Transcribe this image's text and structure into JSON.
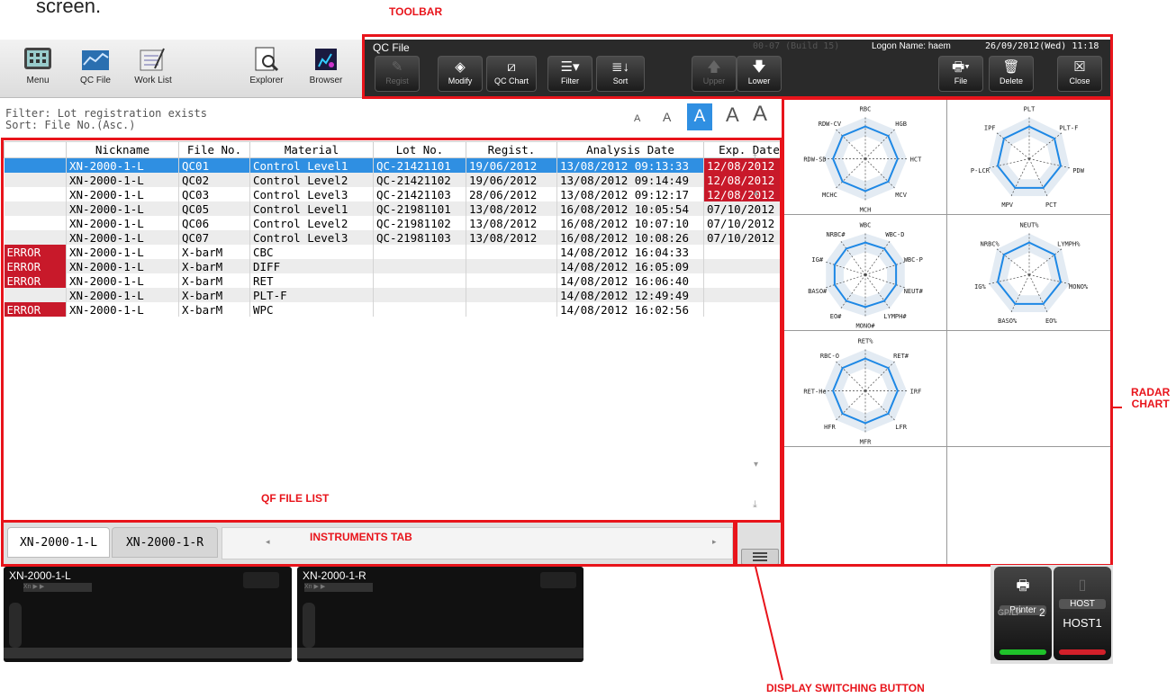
{
  "snippet_text": "screen.",
  "annotations": {
    "toolbar": "TOOLBAR",
    "qf_file_list": "QF FILE LIST",
    "instruments_tab": "INSTRUMENTS TAB",
    "radar_chart_line1": "RADAR",
    "radar_chart_line2": "CHART",
    "display_switching": "DISPLAY SWITCHING BUTTON"
  },
  "left_toolbar": [
    "Menu",
    "QC File",
    "Work List",
    "Explorer",
    "Browser"
  ],
  "dark_toolbar": {
    "title": "QC File",
    "build": "00-07 (Build 15)",
    "logon": "Logon Name: haem",
    "datetime": "26/09/2012(Wed) 11:18",
    "buttons": {
      "regist": "Regist",
      "modify": "Modify",
      "qc_chart": "QC Chart",
      "filter": "Filter",
      "sort": "Sort",
      "upper": "Upper",
      "lower": "Lower",
      "file": "File",
      "delete": "Delete",
      "close": "Close"
    }
  },
  "filter_info": {
    "filter": "Filter: Lot registration exists",
    "sort": "Sort:   File No.(Asc.)"
  },
  "font_sizes": [
    "A",
    "A",
    "A",
    "A",
    "A"
  ],
  "table": {
    "headers": [
      "Nickname",
      "File No.",
      "Material",
      "Lot No.",
      "Regist.",
      "Analysis Date",
      "Exp. Date"
    ],
    "rows": [
      {
        "status": "",
        "cells": [
          "XN-2000-1-L",
          "QC01",
          "Control Level1",
          "QC-21421101",
          "19/06/2012",
          "13/08/2012 09:13:33",
          "12/08/2012"
        ]
      },
      {
        "status": "",
        "cells": [
          "XN-2000-1-L",
          "QC02",
          "Control Level2",
          "QC-21421102",
          "19/06/2012",
          "13/08/2012 09:14:49",
          "12/08/2012"
        ]
      },
      {
        "status": "",
        "cells": [
          "XN-2000-1-L",
          "QC03",
          "Control Level3",
          "QC-21421103",
          "28/06/2012",
          "13/08/2012 09:12:17",
          "12/08/2012"
        ]
      },
      {
        "status": "",
        "cells": [
          "XN-2000-1-L",
          "QC05",
          "Control Level1",
          "QC-21981101",
          "13/08/2012",
          "16/08/2012 10:05:54",
          "07/10/2012"
        ]
      },
      {
        "status": "",
        "cells": [
          "XN-2000-1-L",
          "QC06",
          "Control Level2",
          "QC-21981102",
          "13/08/2012",
          "16/08/2012 10:07:10",
          "07/10/2012"
        ]
      },
      {
        "status": "",
        "cells": [
          "XN-2000-1-L",
          "QC07",
          "Control Level3",
          "QC-21981103",
          "13/08/2012",
          "16/08/2012 10:08:26",
          "07/10/2012"
        ]
      },
      {
        "status": "ERROR",
        "cells": [
          "XN-2000-1-L",
          "X-barM",
          "CBC",
          "",
          "",
          "14/08/2012 16:04:33",
          ""
        ]
      },
      {
        "status": "ERROR",
        "cells": [
          "XN-2000-1-L",
          "X-barM",
          "DIFF",
          "",
          "",
          "14/08/2012 16:05:09",
          ""
        ]
      },
      {
        "status": "ERROR",
        "cells": [
          "XN-2000-1-L",
          "X-barM",
          "RET",
          "",
          "",
          "14/08/2012 16:06:40",
          ""
        ]
      },
      {
        "status": "",
        "cells": [
          "XN-2000-1-L",
          "X-barM",
          "PLT-F",
          "",
          "",
          "14/08/2012 12:49:49",
          ""
        ]
      },
      {
        "status": "ERROR",
        "cells": [
          "XN-2000-1-L",
          "X-barM",
          "WPC",
          "",
          "",
          "14/08/2012 16:02:56",
          ""
        ]
      }
    ]
  },
  "radars": [
    {
      "labels": [
        "RBC",
        "HGB",
        "HCT",
        "MCV",
        "MCH",
        "MCHC",
        "RDW-SD",
        "RDW-CV"
      ]
    },
    {
      "labels": [
        "PLT",
        "PLT-F",
        "PDW",
        "PCT",
        "MPV",
        "P-LCR",
        "IPF"
      ]
    },
    {
      "labels": [
        "WBC",
        "WBC-D",
        "WBC-P",
        "NEUT#",
        "LYMPH#",
        "MONO#",
        "EO#",
        "BASO#",
        "IG#",
        "NRBC#"
      ]
    },
    {
      "labels": [
        "NEUT%",
        "LYMPH%",
        "MONO%",
        "EO%",
        "BASO%",
        "IG%",
        "NRBC%"
      ]
    },
    {
      "labels": [
        "RET%",
        "RET#",
        "IRF",
        "LFR",
        "MFR",
        "HFR",
        "RET-He",
        "RBC-O"
      ]
    }
  ],
  "instrument_tabs": [
    "XN-2000-1-L",
    "XN-2000-1-R"
  ],
  "instruments": [
    {
      "name": "XN-2000-1-L",
      "mini": [
        "Xn",
        "▶",
        "▶"
      ]
    },
    {
      "name": "XN-2000-1-R",
      "mini": [
        "Xn",
        "▶",
        "▶"
      ]
    }
  ],
  "status_buttons": {
    "printer": "Printer",
    "gp_lp": "GP/LP",
    "gp_lp_count": "2",
    "host": "HOST",
    "host_name": "HOST1"
  }
}
